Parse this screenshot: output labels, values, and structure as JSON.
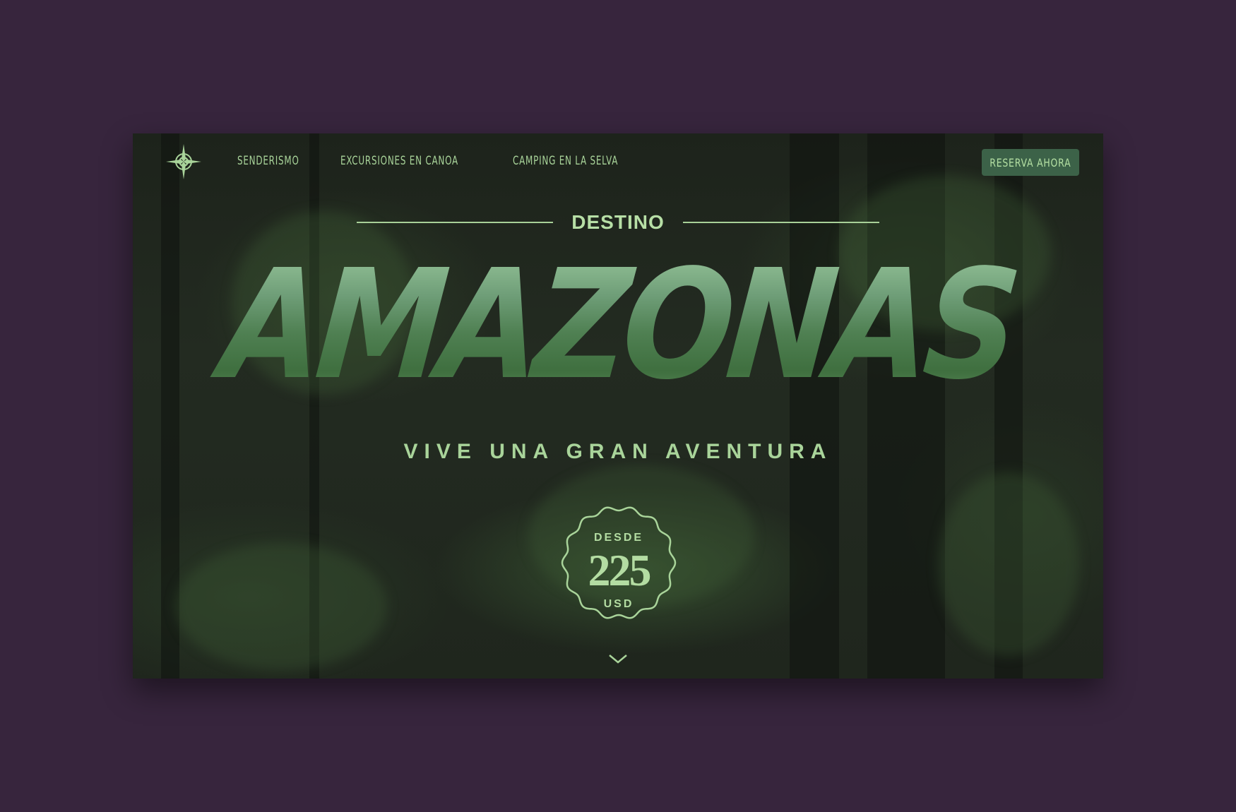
{
  "nav": {
    "logo_icon": "compass-rose-icon",
    "items": [
      {
        "label": "SENDERISMO"
      },
      {
        "label": "EXCURSIONES EN CANOA"
      },
      {
        "label": "CAMPING EN LA SELVA"
      }
    ],
    "cta_label": "RESERVA AHORA"
  },
  "hero": {
    "eyebrow": "DESTINO",
    "title": "AMAZONAS",
    "subtitle": "VIVE UNA GRAN AVENTURA"
  },
  "price_badge": {
    "from": "DESDE",
    "amount": "225",
    "currency": "USD"
  },
  "scroll_icon": "chevron-down-icon",
  "colors": {
    "background": "#37253d",
    "accent": "#a9d49a",
    "cta_bg": "#3c6248"
  }
}
